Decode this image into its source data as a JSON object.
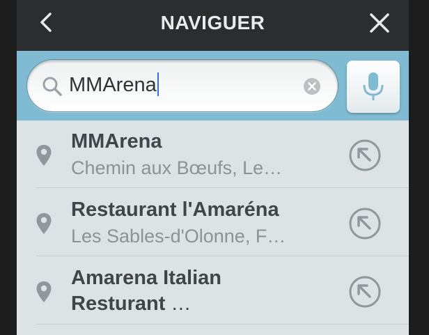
{
  "header": {
    "title": "NAVIGUER",
    "back_icon": "chevron-left-icon",
    "close_icon": "close-icon"
  },
  "search": {
    "value": "MMArena",
    "search_icon": "search-icon",
    "clear_icon": "clear-icon",
    "mic_icon": "microphone-icon"
  },
  "results": [
    {
      "title": "MMArena",
      "subtitle": "Chemin aux Bœufs, Le…"
    },
    {
      "title": "Restaurant l'Amaréna",
      "subtitle": "Les Sables-d'Olonne, F…"
    },
    {
      "title": "Amarena Italian",
      "title_line2": "Resturant",
      "ellipsis": " …"
    }
  ],
  "colors": {
    "header_bg": "#2b2d2e",
    "search_bar_bg": "#7fbcd3",
    "list_bg": "#dde3e5",
    "cursor": "#2d6fe8",
    "icon_gray": "#8f999d"
  }
}
